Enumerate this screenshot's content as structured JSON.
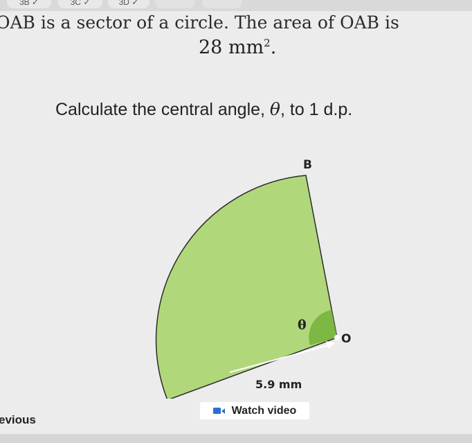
{
  "tabs": [
    "3B",
    "3C",
    "3D",
    "",
    ""
  ],
  "question": {
    "intro": "OAB is a sector of a circle. The area of OAB is",
    "area_value": "28 mm",
    "area_power": "2",
    "area_end": ".",
    "task_before": "Calculate the central angle, ",
    "task_symbol": "θ",
    "task_after": ", to 1 d.p."
  },
  "diagram": {
    "label_b": "B",
    "label_o": "O",
    "label_theta": "θ",
    "radius_label": "5.9 mm",
    "fill_color": "#b1d77b",
    "angle_color": "#7cb843"
  },
  "buttons": {
    "previous": "evious",
    "watch_video": "Watch video",
    "watch_icon_color": "#2d6fd0"
  }
}
